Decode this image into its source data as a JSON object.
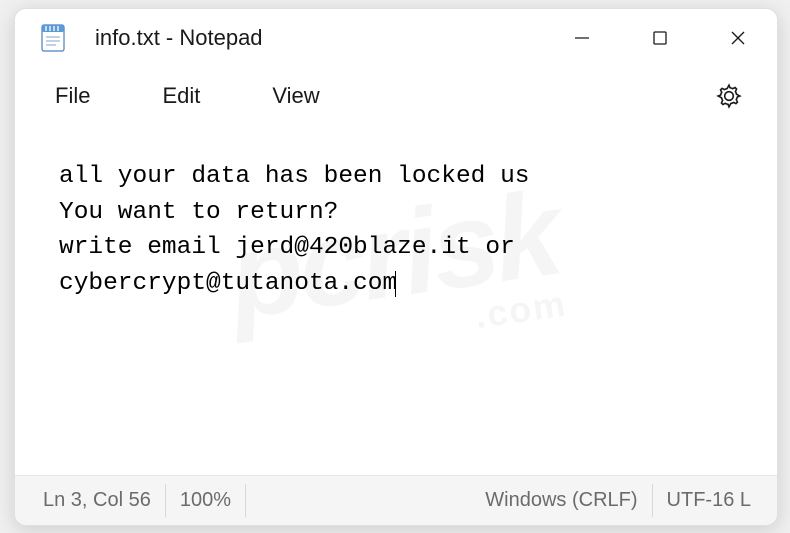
{
  "titlebar": {
    "title": "info.txt - Notepad"
  },
  "menu": {
    "file": "File",
    "edit": "Edit",
    "view": "View"
  },
  "content": {
    "text": "all your data has been locked us\nYou want to return?\nwrite email jerd@420blaze.it or\ncybercrypt@tutanota.com"
  },
  "statusbar": {
    "position": "Ln 3, Col 56",
    "zoom": "100%",
    "eol": "Windows (CRLF)",
    "encoding": "UTF-16 L"
  },
  "watermark": {
    "main": "pcrisk",
    "sub": ".com"
  }
}
